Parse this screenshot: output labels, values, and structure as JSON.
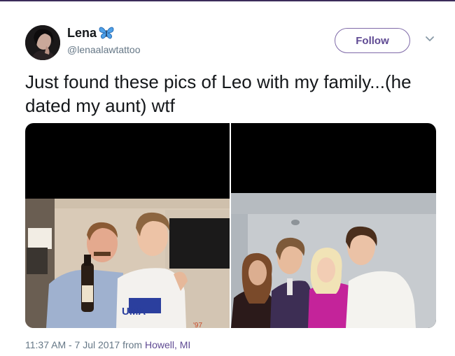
{
  "user": {
    "name": "Lena",
    "handle": "@lenaalawtattoo"
  },
  "follow_label": "Follow",
  "tweet_text": "Just found these pics of Leo with my family...(he dated my aunt) wtf",
  "meta": {
    "timestamp": "11:37 AM - 7 Jul 2017",
    "from_word": "from",
    "location": "Howell, MI"
  },
  "photo_text": {
    "shirt_logo": "UMA",
    "stamp": "'97"
  },
  "colors": {
    "accent": "#5f4a93",
    "follow_border": "#7f6aa8",
    "text": "#14171a",
    "muted": "#657786"
  },
  "icons": [
    "butterfly-emoji",
    "chevron-down-icon"
  ]
}
